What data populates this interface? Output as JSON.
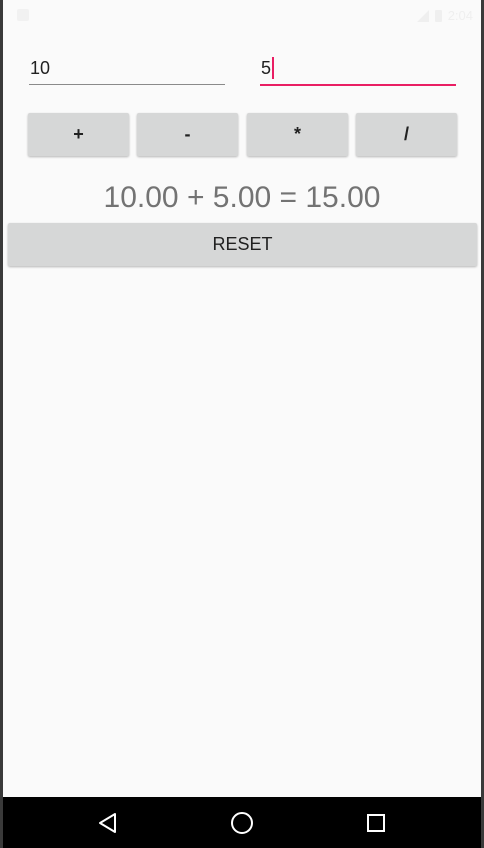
{
  "status_bar": {
    "time": "2:04",
    "icons": [
      "notification-icon",
      "signal-icon",
      "battery-icon"
    ]
  },
  "inputs": {
    "first_value": "10",
    "second_value": "5",
    "focused": "second"
  },
  "operators": [
    {
      "label": "+",
      "name": "add-button"
    },
    {
      "label": "-",
      "name": "subtract-button"
    },
    {
      "label": "*",
      "name": "multiply-button"
    },
    {
      "label": "/",
      "name": "divide-button"
    }
  ],
  "result_text": "10.00 + 5.00 = 15.00",
  "reset_label": "RESET",
  "navigation": {
    "icons": [
      "back-icon",
      "home-icon",
      "recents-icon"
    ]
  },
  "colors": {
    "accent": "#e91e63",
    "button_bg": "#d6d7d7",
    "background": "#fafafa",
    "result_text": "#737373"
  }
}
